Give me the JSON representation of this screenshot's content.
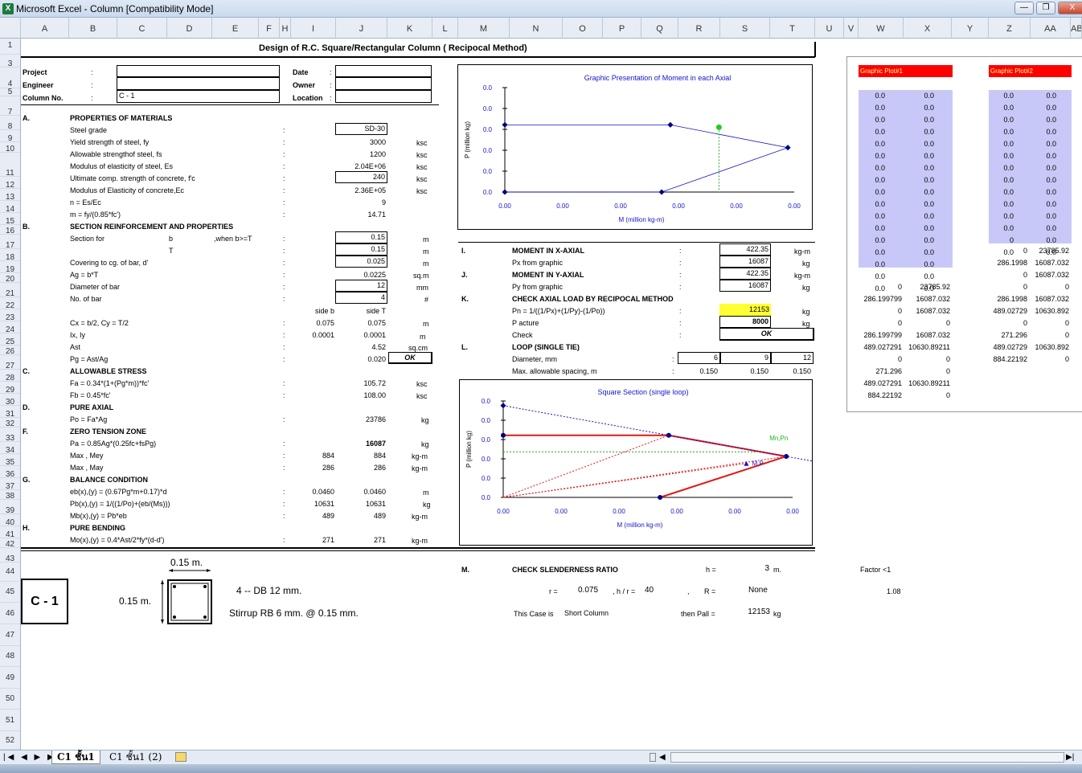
{
  "window": {
    "title": "Microsoft Excel - Column  [Compatibility Mode]",
    "buttons": [
      "—",
      "❐",
      "X"
    ]
  },
  "columns": [
    "A",
    "B",
    "C",
    "D",
    "E",
    "F",
    "H",
    "I",
    "J",
    "K",
    "L",
    "M",
    "N",
    "O",
    "P",
    "Q",
    "R",
    "S",
    "T",
    "U",
    "V",
    "W",
    "X",
    "Y",
    "Z",
    "AA",
    "AB"
  ],
  "rows": [
    "1",
    "3",
    "4",
    "5",
    "7",
    "8",
    "9",
    "10",
    "11",
    "12",
    "13",
    "14",
    "15",
    "16",
    "17",
    "18",
    "19",
    "20",
    "21",
    "22",
    "23",
    "24",
    "25",
    "26",
    "27",
    "28",
    "29",
    "30",
    "31",
    "32",
    "33",
    "34",
    "35",
    "36",
    "37",
    "38",
    "39",
    "40",
    "41",
    "42",
    "43",
    "44",
    "45",
    "46",
    "47",
    "48",
    "49",
    "50",
    "51",
    "52"
  ],
  "sheet_title": "Design  of  R.C. Square/Rectangular Column    ( Recipocal Method)",
  "header": {
    "project_label": "Project",
    "engineer_label": "Engineer",
    "column_label": "Column No.",
    "colon": ":",
    "column_no": "C - 1",
    "date_label": "Date",
    "owner_label": "Owner",
    "location_label": "Location"
  },
  "sections": {
    "A": "A.",
    "A_title": "PROPERTIES OF MATERIALS",
    "B": "B.",
    "B_title": "SECTION REINFORCEMENT AND PROPERTIES",
    "C": "C.",
    "C_title": "ALLOWABLE STRESS",
    "D": "D.",
    "D_title": "PURE AXIAL",
    "F": "F.",
    "F_title": "ZERO TENSION ZONE",
    "G": "G.",
    "G_title": "BALANCE CONDITION",
    "H": "H.",
    "H_title": "PURE BENDING",
    "I": "I.",
    "I_title": "MOMENT IN X-AXIAL",
    "J": "J.",
    "J_title": "MOMENT IN Y-AXIAL",
    "K": "K.",
    "K_title": "CHECK AXIAL LOAD BY RECIPOCAL METHOD",
    "L": "L.",
    "L_title": "LOOP (SINGLE TIE)",
    "M": "M.",
    "M_title": "CHECK SLENDERNESS RATIO"
  },
  "materials": [
    {
      "label": "Steel grade",
      "value": "SD-30",
      "unit": "",
      "boxed": true
    },
    {
      "label": "Yield strength of steel,  fy",
      "value": "3000",
      "unit": "ksc",
      "boxed": false
    },
    {
      "label": "Allowable strengthof steel, fs",
      "value": "1200",
      "unit": "ksc",
      "boxed": false
    },
    {
      "label": "Modulus of elasticity of steel,  Es",
      "value": "2.04E+06",
      "unit": "ksc",
      "boxed": false
    },
    {
      "label": "Ultimate comp. strength of concrete,  f'c",
      "value": "240",
      "unit": "ksc",
      "boxed": true
    },
    {
      "label": "Modulus of Elasticity of concrete,Ec",
      "value": "2.36E+05",
      "unit": "ksc",
      "boxed": false
    },
    {
      "label": "n       =          Es/Ec",
      "value": "9",
      "unit": "",
      "boxed": false
    },
    {
      "label": "m       =          fy/(0.85*fc')",
      "value": "14.71",
      "unit": "",
      "boxed": false
    }
  ],
  "section": {
    "section_for": "Section for",
    "b": "b",
    "when": ",when b>=T",
    "b_value": "0.15",
    "b_unit": "m",
    "T": "T",
    "T_value": "0.15",
    "T_unit": "m",
    "covering": "Covering to cg. of bar,  d'",
    "covering_value": "0.025",
    "covering_unit": "m",
    "ag": "Ag  =  b*T",
    "ag_value": "0.0225",
    "ag_unit": "sq.m",
    "diameter": "Diameter of bar",
    "diameter_value": "12",
    "diameter_unit": "mm",
    "nobar": "No. of bar",
    "nobar_value": "4",
    "nobar_unit": "#",
    "side_b": "side b",
    "side_T": "side T",
    "cx": "Cx  =  b/2,  Cy  =  T/2",
    "cx_b": "0.075",
    "cx_T": "0.075",
    "cx_unit": "m",
    "ix": "Ix,  Iy",
    "ix_b": "0.0001",
    "ix_T": "0.0001",
    "ix_unit": "m",
    "ast": "Ast",
    "ast_value": "4.52",
    "ast_unit": "sq.cm",
    "pg": "Pg  =  Ast/Ag",
    "pg_value": "0.020",
    "pg_check": "OK"
  },
  "allowable": {
    "fa": "Fa  =  0.34*(1+(Pg*m))*fc'",
    "fa_value": "105.72",
    "fa_unit": "ksc",
    "fb": "Fb  =  0.45*fc'",
    "fb_value": "108.00",
    "fb_unit": "ksc"
  },
  "pure_axial": {
    "po": "Po  =  Fa*Ag",
    "po_value": "23786",
    "po_unit": "kg"
  },
  "zero_tension": {
    "pa": "Pa  =  0.85Ag*(0.25fc+fsPg)",
    "pa_value": "16087",
    "pa_unit": "kg",
    "max1": "Max ,   Mey",
    "max1_b": "884",
    "max1_T": "884",
    "max1_unit": "kg-m",
    "max2": "Max ,   May",
    "max2_b": "286",
    "max2_T": "286",
    "max2_unit": "kg-m"
  },
  "balance": {
    "eb": "eb(x),(y)  =  (0.67Pg*m+0.17)*d",
    "eb_b": "0.0460",
    "eb_T": "0.0460",
    "eb_unit": "m",
    "pb": "Pb(x),(y)  =  1/((1/Po)+(eb/(Ms)))",
    "pb_b": "10631",
    "pb_T": "10631",
    "pb_unit": "kg",
    "mb": "Mb(x),(y)  =  Pb*eb",
    "mb_b": "489",
    "mb_T": "489",
    "mb_unit": "kg-m"
  },
  "pure_bending": {
    "mo": "Mo(x),(y)  =  0.4*Ast/2*fy*(d-d')",
    "mo_b": "271",
    "mo_T": "271",
    "mo_unit": "kg-m"
  },
  "moment": {
    "mx_value": "422.35",
    "mx_unit": "kg-m",
    "px_label": "Px from graphic",
    "px_value": "16087",
    "px_unit": "kg",
    "my_value": "422.35",
    "my_unit": "kg-m",
    "py_label": "Py from graphic",
    "py_value": "16087",
    "py_unit": "kg"
  },
  "check_axial": {
    "pn_label": "Pn  =  1/((1/Px)+(1/Py)-(1/Po))",
    "pn_value": "12153",
    "pn_unit": "kg",
    "pact_label": "P acture",
    "pact_value": "8000",
    "pact_unit": "kg",
    "check_label": "Check",
    "check_value": "OK"
  },
  "loop": {
    "diameter_label": "Diameter, mm",
    "diameters": [
      "6",
      "9",
      "12"
    ],
    "spacing_label": "Max. allowable spacing, m",
    "spacings": [
      "0.150",
      "0.150",
      "0.150"
    ]
  },
  "slenderness": {
    "h_label": "h =",
    "h_value": "3",
    "h_unit": "m.",
    "r_label": "r =",
    "r_value": "0.075",
    "hr_label": ",  h / r  =",
    "hr_value": "40",
    "comma": ",",
    "R_label": "R =",
    "R_value": "None",
    "case_label": "This Case is",
    "case_value": "Short Column",
    "pall_label": "then Pall =",
    "pall_value": "12153",
    "pall_unit": "kg",
    "factor_label": "Factor <1",
    "factor_value": "1.08"
  },
  "drawing": {
    "dim_top": "0.15  m.",
    "dim_left": "0.15  m.",
    "label": "C - 1",
    "bars": "4 --   DB 12 mm.",
    "stirrup": "Stirrup RB 6 mm.  @ 0.15 mm."
  },
  "chart1": {
    "title": "Graphic  Presentation  of  Moment  in  each  Axial",
    "xlabel": "M  (million kg-m)",
    "ylabel": "P  (million kg)",
    "xticks": [
      "0.00",
      "0.00",
      "0.00",
      "0.00",
      "0.00",
      "0.00"
    ],
    "yticks": [
      "0.0",
      "0.0",
      "0.0",
      "0.0",
      "0.0",
      "0.0"
    ],
    "colors": {
      "series": "#1414c8",
      "point": "#22cc22",
      "guide": "#22aa22"
    }
  },
  "chart2": {
    "title": "Square  Section  (single  loop)",
    "xlabel": "M  (million kg-m)",
    "ylabel": "P  (million kg)",
    "xticks": [
      "0.00",
      "0.00",
      "0.00",
      "0.00",
      "0.00",
      "0.00"
    ],
    "yticks": [
      "0.0",
      "0.0",
      "0.0",
      "0.0",
      "0.0",
      "0.0"
    ],
    "label_mn": "Mn,Pn",
    "label_mp": "M,P",
    "colors": {
      "curve": "#e01818",
      "dotted": "#1414c8",
      "guide": "#22aa22"
    }
  },
  "chart_data": [
    {
      "type": "line",
      "title": "Graphic  Presentation  of  Moment  in  each  Axial",
      "xlabel": "M  (million kg-m)",
      "ylabel": "P  (million kg)",
      "series": [
        {
          "x": [
            0,
            0.000286,
            0.000489,
            0.000271,
            0
          ],
          "y": [
            0.016087,
            0.016087,
            0.010631,
            0,
            0
          ]
        }
      ],
      "xlim": [
        0,
        0.0005
      ],
      "ylim": [
        0,
        0.025
      ]
    },
    {
      "type": "line",
      "title": "Square  Section  (single  loop)",
      "xlabel": "M  (million kg-m)",
      "ylabel": "P  (million kg)",
      "series": [
        {
          "x": [
            0,
            0.000286,
            0.000489,
            0.000271
          ],
          "y": [
            0.016087,
            0.016087,
            0.010631,
            0
          ]
        }
      ],
      "xlim": [
        0,
        0.0005
      ],
      "ylim": [
        0,
        0.025
      ]
    }
  ],
  "panel": {
    "plot1_title": "Graphic Plot#1",
    "plot2_title": "Graphic Plot#2",
    "zero_w": "0.0",
    "zero_x": "0.0",
    "plot1_tail": [
      [
        "0.0",
        "0.0"
      ],
      [
        "0.0",
        "0.0"
      ]
    ],
    "plot2_rows": [
      [
        "0.0",
        "0.0"
      ],
      [
        "0.0",
        "0.0"
      ],
      [
        "0.0",
        "0.0"
      ],
      [
        "0.0",
        "0.0"
      ],
      [
        "0.0",
        "0.0"
      ],
      [
        "0.0",
        "0.0"
      ],
      [
        "0.0",
        "0.0"
      ],
      [
        "0.0",
        "0.0"
      ],
      [
        "0.0",
        "0.0"
      ],
      [
        "0.0",
        "0.0"
      ],
      [
        "0.0",
        "0.0"
      ],
      [
        "0.0",
        "0.0"
      ],
      [
        "0",
        "0.0"
      ],
      [
        "0.0",
        "0.0"
      ]
    ],
    "plot2_tail": [
      [
        "0",
        "23785.92"
      ],
      [
        "286.1998",
        "16087.032"
      ],
      [
        "0",
        "16087.032"
      ],
      [
        "0",
        "0"
      ],
      [
        "286.1998",
        "16087.032"
      ],
      [
        "489.02729",
        "10630.892"
      ],
      [
        "0",
        "0"
      ],
      [
        "271.296",
        "0"
      ],
      [
        "489.02729",
        "10630.892"
      ],
      [
        "884.22192",
        "0"
      ]
    ],
    "lower1": [
      [
        "0",
        "23785.92"
      ],
      [
        "286.199799",
        "16087.032"
      ],
      [
        "0",
        "16087.032"
      ],
      [
        "0",
        "0"
      ],
      [
        "286.199799",
        "16087.032"
      ],
      [
        "489.027291",
        "10630.89211"
      ],
      [
        "0",
        "0"
      ],
      [
        "271.296",
        "0"
      ],
      [
        "489.027291",
        "10630.89211"
      ],
      [
        "884.22192",
        "0"
      ]
    ]
  },
  "sheet_tabs": [
    "C1 ชั้น1",
    "C1 ชั้น1 (2)"
  ],
  "colors": {
    "red_header": "#ff0000",
    "blue_fill": "#c8c8f8",
    "yellow": "#ffff33"
  }
}
